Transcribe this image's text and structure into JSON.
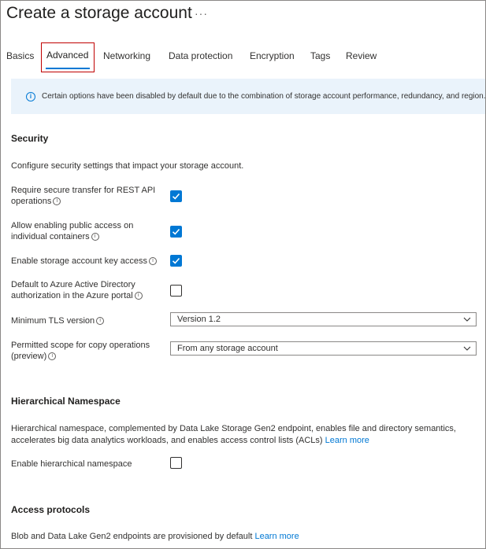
{
  "header": {
    "title": "Create a storage account",
    "more_label": "···"
  },
  "tabs": [
    {
      "label": "Basics"
    },
    {
      "label": "Advanced"
    },
    {
      "label": "Networking"
    },
    {
      "label": "Data protection"
    },
    {
      "label": "Encryption"
    },
    {
      "label": "Tags"
    },
    {
      "label": "Review"
    }
  ],
  "active_tab": "Advanced",
  "info_bar": {
    "icon": "info-icon",
    "text": "Certain options have been disabled by default due to the combination of storage account performance, redundancy, and region."
  },
  "security": {
    "heading": "Security",
    "description": "Configure security settings that impact your storage account.",
    "fields": [
      {
        "label": "Require secure transfer for REST API operations",
        "type": "checkbox",
        "checked": true
      },
      {
        "label": "Allow enabling public access on individual containers",
        "type": "checkbox",
        "checked": true
      },
      {
        "label": "Enable storage account key access",
        "type": "checkbox",
        "checked": true
      },
      {
        "label": "Default to Azure Active Directory authorization in the Azure portal",
        "type": "checkbox",
        "checked": false
      },
      {
        "label": "Minimum TLS version",
        "type": "dropdown",
        "value": "Version 1.2"
      },
      {
        "label": "Permitted scope for copy operations (preview)",
        "type": "dropdown",
        "value": "From any storage account"
      }
    ]
  },
  "hierarchical": {
    "heading": "Hierarchical Namespace",
    "description": "Hierarchical namespace, complemented by Data Lake Storage Gen2 endpoint, enables file and directory semantics, accelerates big data analytics workloads, and enables access control lists (ACLs)",
    "learn_more": "Learn more",
    "field": {
      "label": "Enable hierarchical namespace",
      "type": "checkbox",
      "checked": false
    }
  },
  "access_protocols": {
    "heading": "Access protocols",
    "description": "Blob and Data Lake Gen2 endpoints are provisioned by default",
    "learn_more": "Learn more"
  },
  "colors": {
    "accent": "#0078d4",
    "highlight_box": "#c00000",
    "info_background": "#eaf3fb"
  }
}
